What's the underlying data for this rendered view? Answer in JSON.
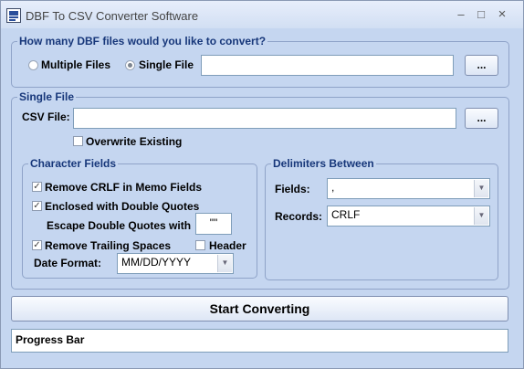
{
  "window": {
    "title": "DBF To CSV Converter Software",
    "minimize": "–",
    "maximize": "□",
    "close": "×"
  },
  "mode": {
    "legend": "How many DBF files would you like to convert?",
    "multiple_label": "Multiple Files",
    "single_label": "Single File",
    "selected": "Single File",
    "path_value": "",
    "browse_label": "..."
  },
  "single_file": {
    "legend": "Single File",
    "csv_label": "CSV File:",
    "csv_value": "",
    "browse_label": "...",
    "overwrite_label": "Overwrite Existing",
    "overwrite_checked": false
  },
  "character_fields": {
    "legend": "Character Fields",
    "remove_crlf_label": "Remove CRLF in Memo Fields",
    "remove_crlf_checked": true,
    "enclosed_label": "Enclosed with Double Quotes",
    "enclosed_checked": true,
    "escape_label": "Escape Double Quotes with",
    "escape_value": "\"\"",
    "trailing_label": "Remove Trailing Spaces",
    "trailing_checked": true,
    "header_label": "Header",
    "header_checked": false,
    "date_label": "Date Format:",
    "date_value": "MM/DD/YYYY"
  },
  "delimiters": {
    "legend": "Delimiters Between",
    "fields_label": "Fields:",
    "fields_value": ",",
    "records_label": "Records:",
    "records_value": "CRLF"
  },
  "start_button": "Start Converting",
  "progress_text": "Progress Bar",
  "icons": {
    "check": "✓",
    "dropdown": "▼"
  }
}
